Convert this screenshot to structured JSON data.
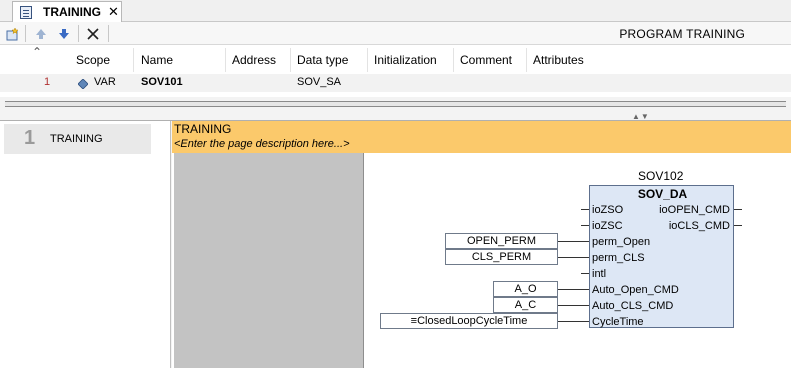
{
  "tab": {
    "title": "TRAINING",
    "close": "✕"
  },
  "toolbar": {
    "program_title": "PROGRAM TRAINING"
  },
  "vartable": {
    "collapse": "⌃",
    "headers": [
      "Scope",
      "Name",
      "Address",
      "Data type",
      "Initialization",
      "Comment",
      "Attributes"
    ],
    "rows": [
      {
        "num": "1",
        "scope": "VAR",
        "name": "SOV101",
        "address": "",
        "type": "SOV_SA",
        "init": "",
        "comment": "",
        "attributes": ""
      }
    ]
  },
  "splitter_arrows": "▲▼",
  "pages": [
    {
      "num": "1",
      "name": "TRAINING"
    }
  ],
  "page": {
    "title": "TRAINING",
    "description": "<Enter the page description here...>"
  },
  "fb": {
    "instance": "SOV102",
    "type": "SOV_DA",
    "inputs": [
      "ioZSO",
      "ioZSC",
      "perm_Open",
      "perm_CLS",
      "intl",
      "Auto_Open_CMD",
      "Auto_CLS_CMD",
      "CycleTime"
    ],
    "outputs": [
      "ioOPEN_CMD",
      "ioCLS_CMD"
    ]
  },
  "variables": {
    "perm_open": "OPEN_PERM",
    "perm_cls": "CLS_PERM",
    "auto_open": "A_O",
    "auto_cls": "A_C",
    "cycle_time": "≡ClosedLoopCycleTime"
  },
  "colors": {
    "header_band": "#fbc96b",
    "fb_fill": "#dde7f5",
    "gray_column": "#c3c3c3"
  }
}
